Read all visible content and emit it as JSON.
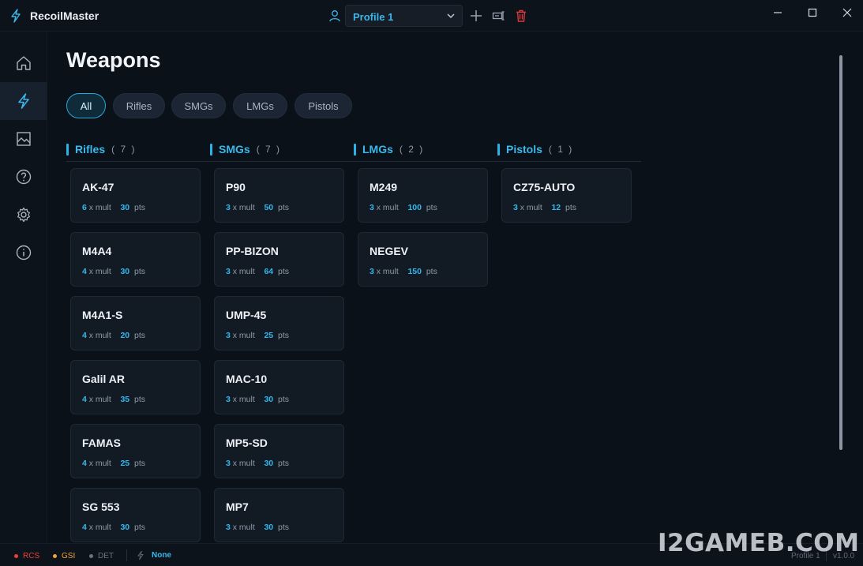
{
  "app": {
    "title": "RecoilMaster"
  },
  "profile": {
    "selected": "Profile 1"
  },
  "sidebar": {
    "items": [
      {
        "name": "home"
      },
      {
        "name": "weapons"
      },
      {
        "name": "gallery"
      },
      {
        "name": "help"
      },
      {
        "name": "settings"
      },
      {
        "name": "info"
      }
    ]
  },
  "page": {
    "title": "Weapons"
  },
  "filters": [
    "All",
    "Rifles",
    "SMGs",
    "LMGs",
    "Pistols"
  ],
  "labels": {
    "mult": "x mult",
    "pts": "pts"
  },
  "categories": [
    {
      "name": "Rifles",
      "count": "( 7 )",
      "weapons": [
        {
          "name": "AK-47",
          "mult": "6",
          "pts": "30"
        },
        {
          "name": "M4A4",
          "mult": "4",
          "pts": "30"
        },
        {
          "name": "M4A1-S",
          "mult": "4",
          "pts": "20"
        },
        {
          "name": "Galil AR",
          "mult": "4",
          "pts": "35"
        },
        {
          "name": "FAMAS",
          "mult": "4",
          "pts": "25"
        },
        {
          "name": "SG 553",
          "mult": "4",
          "pts": "30"
        }
      ]
    },
    {
      "name": "SMGs",
      "count": "( 7 )",
      "weapons": [
        {
          "name": "P90",
          "mult": "3",
          "pts": "50"
        },
        {
          "name": "PP-BIZON",
          "mult": "3",
          "pts": "64"
        },
        {
          "name": "UMP-45",
          "mult": "3",
          "pts": "25"
        },
        {
          "name": "MAC-10",
          "mult": "3",
          "pts": "30"
        },
        {
          "name": "MP5-SD",
          "mult": "3",
          "pts": "30"
        },
        {
          "name": "MP7",
          "mult": "3",
          "pts": "30"
        }
      ]
    },
    {
      "name": "LMGs",
      "count": "( 2 )",
      "weapons": [
        {
          "name": "M249",
          "mult": "3",
          "pts": "100"
        },
        {
          "name": "NEGEV",
          "mult": "3",
          "pts": "150"
        }
      ]
    },
    {
      "name": "Pistols",
      "count": "( 1 )",
      "weapons": [
        {
          "name": "CZ75-AUTO",
          "mult": "3",
          "pts": "12"
        }
      ]
    }
  ],
  "status": {
    "rcs": "RCS",
    "gsi": "GSI",
    "det": "DET",
    "weapon": "None",
    "profile": "Profile 1",
    "version": "v1.0.0"
  },
  "colors": {
    "accent": "#29b3e6",
    "rcs": "#e8403a",
    "gsi": "#f0a33a",
    "det": "#6d7480",
    "delete": "#d83a3a"
  },
  "watermark": "I2GAMEB.COM"
}
